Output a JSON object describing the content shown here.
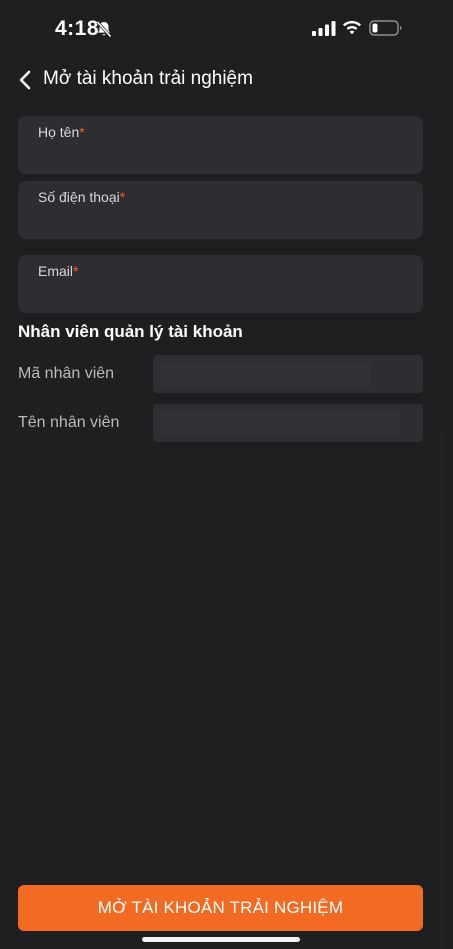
{
  "status_bar": {
    "time": "4:18",
    "icons": [
      "bell-off-icon",
      "signal-icon",
      "wifi-icon",
      "battery-icon"
    ]
  },
  "header": {
    "back_icon": "chevron-left-icon",
    "title": "Mở tài khoản trải nghiệm"
  },
  "form": {
    "full_name": {
      "label": "Họ tên",
      "required_mark": "*",
      "value": ""
    },
    "phone": {
      "label": "Số điện thoại",
      "required_mark": "*",
      "value": ""
    },
    "email": {
      "label": "Email",
      "required_mark": "*",
      "value": ""
    }
  },
  "manager_section": {
    "title": "Nhân viên quản lý tài khoản",
    "employee_code": {
      "label": "Mã nhân viên",
      "value": ""
    },
    "employee_name": {
      "label": "Tên nhân viên",
      "value": ""
    }
  },
  "submit": {
    "label": "MỞ TÀI KHOẢN TRẢI NGHIỆM"
  },
  "colors": {
    "background": "#1d1f21",
    "field_background": "#2c2e32",
    "accent": "#f36b22",
    "required": "#ff5a1f"
  }
}
